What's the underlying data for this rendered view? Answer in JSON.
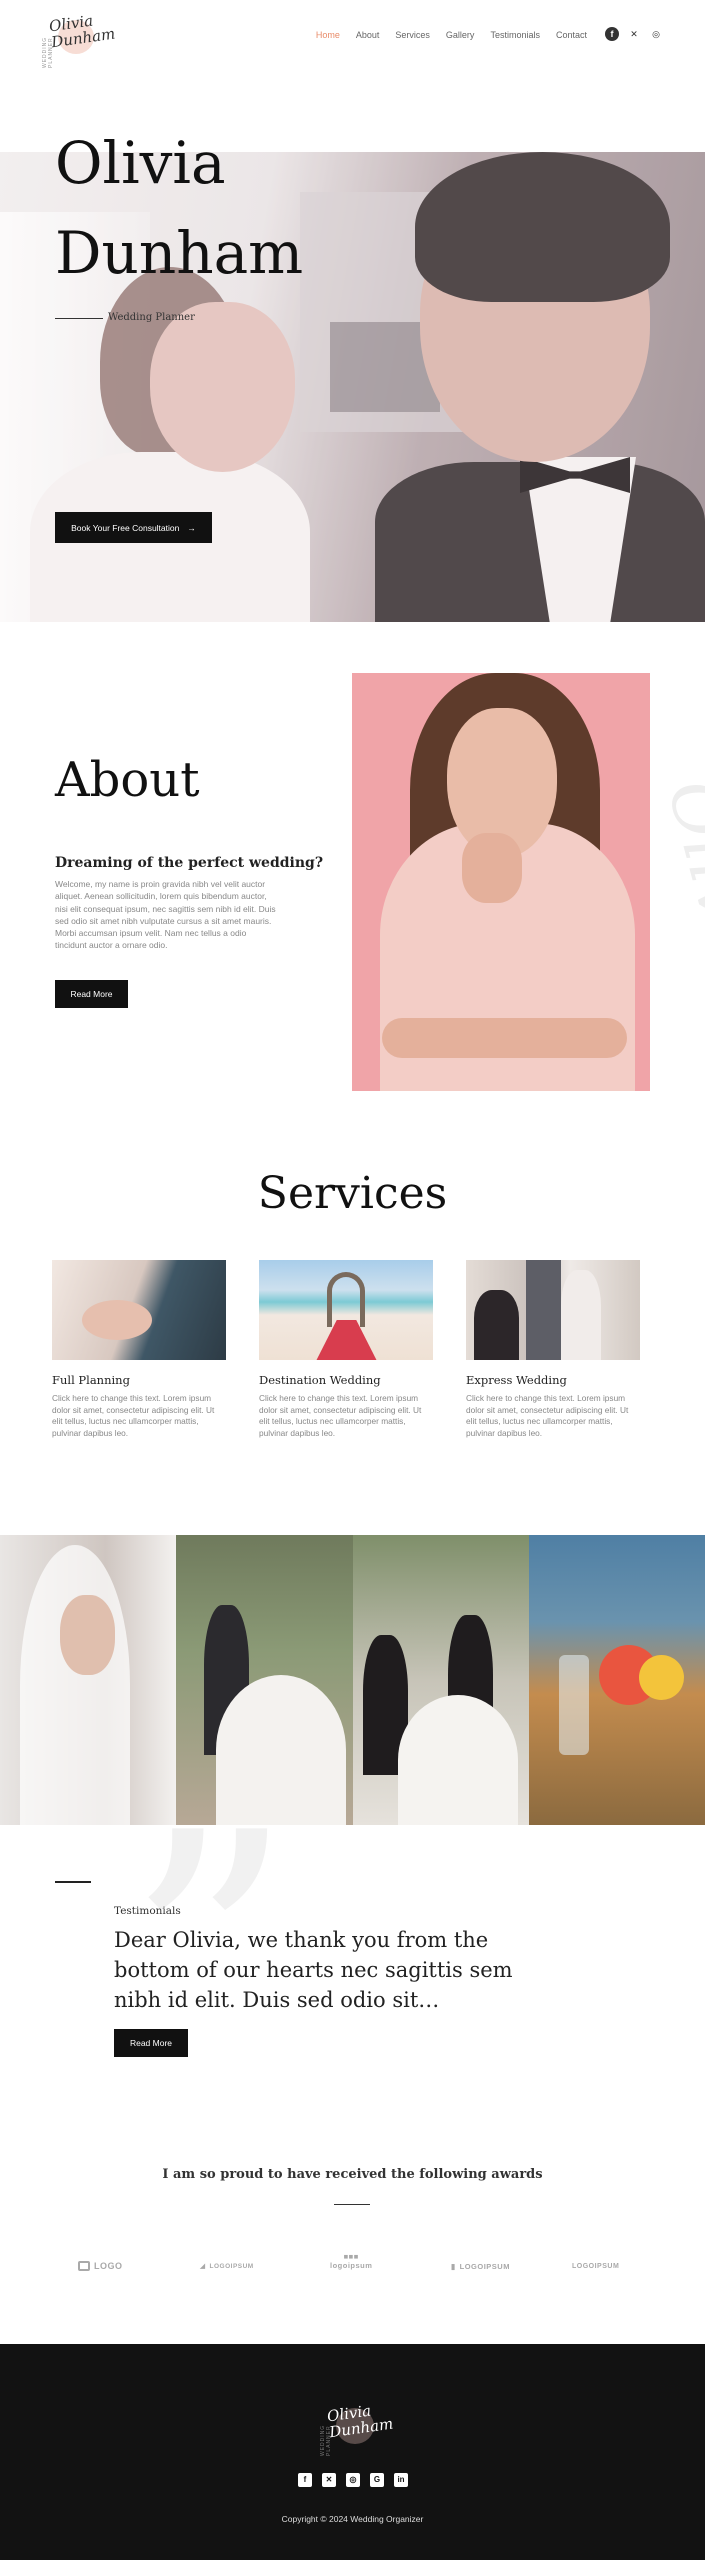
{
  "brand": {
    "logo_script": "Olivia\nDunham",
    "logo_vertical": "WEDDING PLANNER"
  },
  "nav": {
    "items": [
      {
        "label": "Home",
        "active": true
      },
      {
        "label": "About",
        "active": false
      },
      {
        "label": "Services",
        "active": false
      },
      {
        "label": "Gallery",
        "active": false
      },
      {
        "label": "Testimonials",
        "active": false
      },
      {
        "label": "Contact",
        "active": false
      }
    ],
    "social": [
      {
        "icon": "facebook-icon",
        "glyph": "f"
      },
      {
        "icon": "x-icon",
        "glyph": "✕"
      },
      {
        "icon": "instagram-icon",
        "glyph": "◎"
      }
    ]
  },
  "hero": {
    "title": "Olivia\nDunham",
    "subtitle": "Wedding Planner",
    "cta_label": "Book Your Free Consultation",
    "cta_icon": "arrow-right-icon",
    "cta_glyph": "→"
  },
  "about": {
    "title": "About",
    "heading": "Dreaming of the perfect wedding?",
    "text": "Welcome, my name is proin gravida nibh vel velit auctor aliquet. Aenean sollicitudin, lorem quis bibendum auctor, nisi elit consequat ipsum, nec sagittis sem nibh id elit. Duis sed odio sit amet nibh vulputate cursus a sit amet mauris. Morbi accumsan ipsum velit. Nam nec tellus a odio tincidunt auctor a ornare odio.",
    "button_label": "Read More"
  },
  "services": {
    "title": "Services",
    "items": [
      {
        "title": "Full Planning",
        "text": "Click here to change this text. Lorem ipsum dolor sit amet, consectetur adipiscing elit. Ut elit tellus, luctus nec ullamcorper mattis, pulvinar dapibus leo."
      },
      {
        "title": "Destination Wedding",
        "text": "Click here to change this text. Lorem ipsum dolor sit amet, consectetur adipiscing elit. Ut elit tellus, luctus nec ullamcorper mattis, pulvinar dapibus leo."
      },
      {
        "title": "Express Wedding",
        "text": "Click here to change this text. Lorem ipsum dolor sit amet, consectetur adipiscing elit. Ut elit tellus, luctus nec ullamcorper mattis, pulvinar dapibus leo."
      }
    ]
  },
  "testimonial": {
    "label": "Testimonials",
    "quote": "Dear Olivia, we thank you from the bottom of our hearts nec sagittis sem nibh id elit. Duis sed odio sit…",
    "button_label": "Read More",
    "quote_mark": "”"
  },
  "awards": {
    "title": "I am so proud to have received the following awards",
    "logos": [
      "LOGO",
      "LOGOIPSUM",
      "logoipsum",
      "LOGOIPSUM",
      "LOGOIPSUM"
    ]
  },
  "footer": {
    "social": [
      {
        "icon": "facebook-icon",
        "glyph": "f"
      },
      {
        "icon": "x-icon",
        "glyph": "✕"
      },
      {
        "icon": "instagram-icon",
        "glyph": "◎"
      },
      {
        "icon": "google-icon",
        "glyph": "G"
      },
      {
        "icon": "linkedin-icon",
        "glyph": "in"
      }
    ],
    "copyright": "Copyright © 2024 Wedding Organizer"
  },
  "colors": {
    "accent": "#e98c6a",
    "dark": "#111111",
    "footer_bg": "#121212",
    "about_bg": "#f0a4a8"
  }
}
